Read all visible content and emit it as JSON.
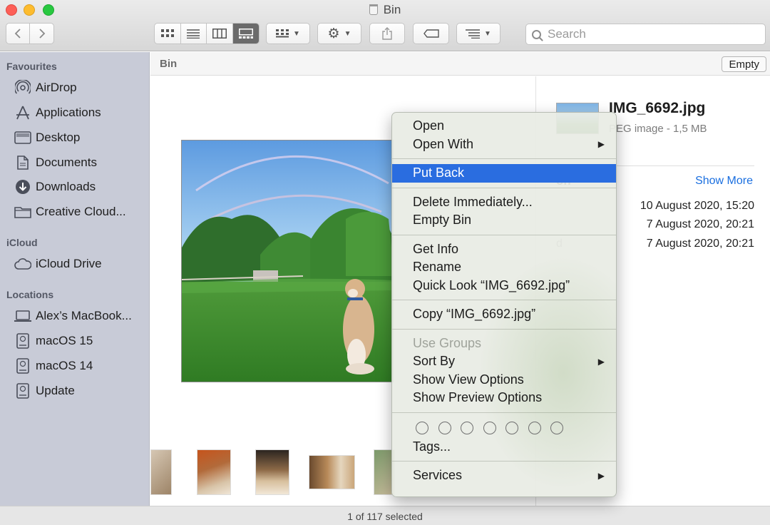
{
  "window": {
    "title": "Bin"
  },
  "toolbar": {
    "search_placeholder": "Search",
    "view_modes": [
      "icon-view",
      "list-view",
      "column-view",
      "gallery-view"
    ],
    "active_view": "gallery-view"
  },
  "sidebar": {
    "sections": [
      {
        "heading": "Favourites",
        "items": [
          {
            "label": "AirDrop",
            "icon": "airdrop-icon"
          },
          {
            "label": "Applications",
            "icon": "applications-icon"
          },
          {
            "label": "Desktop",
            "icon": "desktop-icon"
          },
          {
            "label": "Documents",
            "icon": "documents-icon"
          },
          {
            "label": "Downloads",
            "icon": "downloads-icon"
          },
          {
            "label": "Creative Cloud...",
            "icon": "folder-icon"
          }
        ]
      },
      {
        "heading": "iCloud",
        "items": [
          {
            "label": "iCloud Drive",
            "icon": "cloud-icon"
          }
        ]
      },
      {
        "heading": "Locations",
        "items": [
          {
            "label": "Alex’s MacBook...",
            "icon": "laptop-icon"
          },
          {
            "label": "macOS 15",
            "icon": "disk-icon"
          },
          {
            "label": "macOS 14",
            "icon": "disk-icon"
          },
          {
            "label": "Update",
            "icon": "disk-icon"
          }
        ]
      }
    ]
  },
  "pathbar": {
    "title": "Bin",
    "empty_button": "Empty"
  },
  "preview": {
    "file_name": "IMG_6692.jpg",
    "kind": "PEG image - 1,5 MB",
    "info_heading": "on",
    "show_more": "Show More",
    "rows": [
      {
        "key": "",
        "value": "10 August 2020, 15:20"
      },
      {
        "key": "",
        "value": "7 August 2020, 20:21"
      },
      {
        "key": "d",
        "value": "7 August 2020, 20:21"
      }
    ]
  },
  "context_menu": {
    "groups": [
      [
        {
          "label": "Open"
        },
        {
          "label": "Open With",
          "submenu": true
        }
      ],
      [
        {
          "label": "Put Back",
          "highlighted": true
        }
      ],
      [
        {
          "label": "Delete Immediately..."
        },
        {
          "label": "Empty Bin"
        }
      ],
      [
        {
          "label": "Get Info"
        },
        {
          "label": "Rename"
        },
        {
          "label": "Quick Look “IMG_6692.jpg”"
        }
      ],
      [
        {
          "label": "Copy “IMG_6692.jpg”"
        }
      ],
      [
        {
          "label": "Use Groups",
          "disabled": true
        },
        {
          "label": "Sort By",
          "submenu": true
        },
        {
          "label": "Show View Options"
        },
        {
          "label": "Show Preview Options"
        }
      ]
    ],
    "tags_label": "Tags...",
    "tag_count": 7,
    "services_label": "Services"
  },
  "status": {
    "text": "1 of 117 selected"
  },
  "colors": {
    "highlight": "#2a6de0",
    "sidebar": "#c8cbd7",
    "link": "#1a6fe0"
  }
}
